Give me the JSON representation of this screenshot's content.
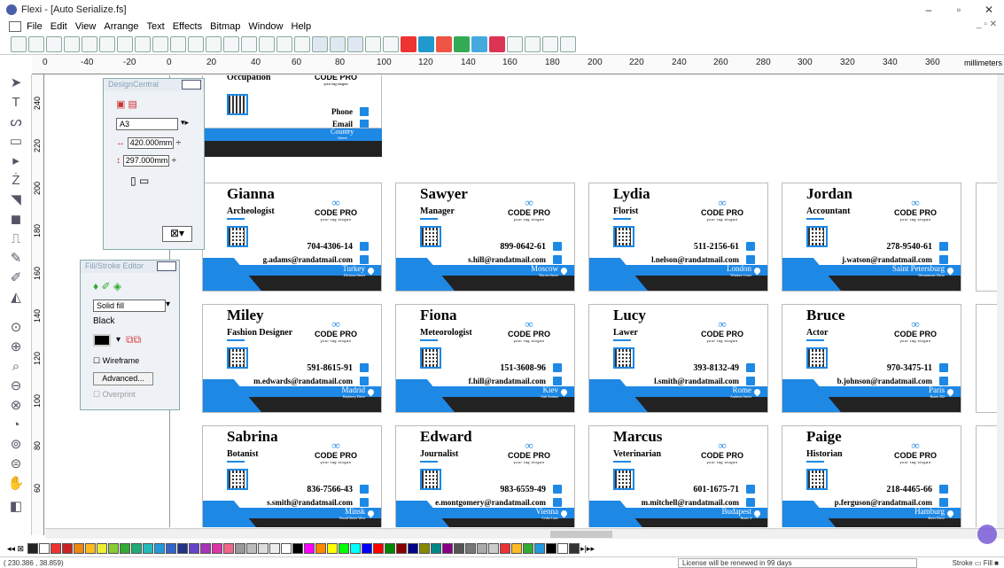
{
  "window": {
    "title": "Flexi - [Auto Serialize.fs]",
    "min": "–",
    "max": "▫",
    "close": "✕"
  },
  "menu": [
    "File",
    "Edit",
    "View",
    "Arrange",
    "Text",
    "Effects",
    "Bitmap",
    "Window",
    "Help"
  ],
  "menu_right": "_ ▫ ✕",
  "ruler": {
    "unit": "millimeters",
    "h_labels": [
      "0",
      "-40",
      "-20",
      "0",
      "20",
      "40",
      "60",
      "80",
      "100",
      "120",
      "140",
      "160",
      "180",
      "200",
      "220",
      "240",
      "260",
      "280",
      "300",
      "320",
      "340",
      "360"
    ],
    "v_labels": [
      "240",
      "220",
      "200",
      "180",
      "160",
      "140",
      "120",
      "100",
      "80",
      "60"
    ]
  },
  "design_central": {
    "title": "DesignCentral",
    "size": "A3",
    "width": "420.000mm",
    "height": "297.000mm"
  },
  "fill_stroke": {
    "title": "Fill/Stroke Editor",
    "fill_type": "Solid fill",
    "color_name": "Black",
    "wireframe": "Wireframe",
    "advanced": "Advanced...",
    "overprint": "Overprint"
  },
  "top_card": {
    "job": "Occupation",
    "phone_label": "Phone",
    "email_label": "Email",
    "country": "Country",
    "street": "Street"
  },
  "brand": {
    "name": "CODE PRO",
    "slogan": "your tag slogan",
    "infinity": "∞"
  },
  "cards": [
    {
      "name": "Gianna",
      "job": "Archeologist",
      "phone": "704-4306-14",
      "email": "g.adams@randatmail.com",
      "city": "Turkey",
      "street": "Division Street"
    },
    {
      "name": "Sawyer",
      "job": "Manager",
      "phone": "899-0642-61",
      "email": "s.hill@randatmail.com",
      "city": "Moscow",
      "street": "Warren Street"
    },
    {
      "name": "Lydia",
      "job": "Florist",
      "phone": "511-2156-61",
      "email": "l.nelson@randatmail.com",
      "city": "London",
      "street": "Windsor Court"
    },
    {
      "name": "Jordan",
      "job": "Accountant",
      "phone": "278-9540-61",
      "email": "j.watson@randatmail.com",
      "city": "Saint Petersburg",
      "street": "Westminster Drive"
    },
    {
      "name": "Miley",
      "job": "Fashion Designer",
      "phone": "591-8615-91",
      "email": "m.edwards@randatmail.com",
      "city": "Madrid",
      "street": "Bayberry Drive"
    },
    {
      "name": "Fiona",
      "job": "Meteorologist",
      "phone": "151-3608-96",
      "email": "f.hill@randatmail.com",
      "city": "Kiev",
      "street": "Oak Avenue"
    },
    {
      "name": "Lucy",
      "job": "Lawer",
      "phone": "393-8132-49",
      "email": "l.smith@randatmail.com",
      "city": "Rome",
      "street": "Amherst Street"
    },
    {
      "name": "Bruce",
      "job": "Actor",
      "phone": "970-3475-11",
      "email": "b.johnson@randatmail.com",
      "city": "Paris",
      "street": "Route 202"
    },
    {
      "name": "Sabrina",
      "job": "Botanist",
      "phone": "836-7566-43",
      "email": "s.smith@randatmail.com",
      "city": "Minsk",
      "street": "Broad Street West"
    },
    {
      "name": "Edward",
      "job": "Journalist",
      "phone": "983-6559-49",
      "email": "e.montgomery@randatmail.com",
      "city": "Vienna",
      "street": "Cedar Lane"
    },
    {
      "name": "Marcus",
      "job": "Veterinarian",
      "phone": "601-1675-71",
      "email": "m.mitchell@randatmail.com",
      "city": "Budapest",
      "street": "Route 4"
    },
    {
      "name": "Paige",
      "job": "Historian",
      "phone": "218-4465-66",
      "email": "p.ferguson@randatmail.com",
      "city": "Hamburg",
      "street": "Sheet Drive"
    }
  ],
  "status": {
    "coords": "( 230.386 , 38.859)",
    "license": "License will be renewed in 99 days",
    "stroke": "Stroke",
    "fill": "Fill"
  },
  "colors": {
    "accent": "#1e88e5",
    "dark": "#222222"
  }
}
